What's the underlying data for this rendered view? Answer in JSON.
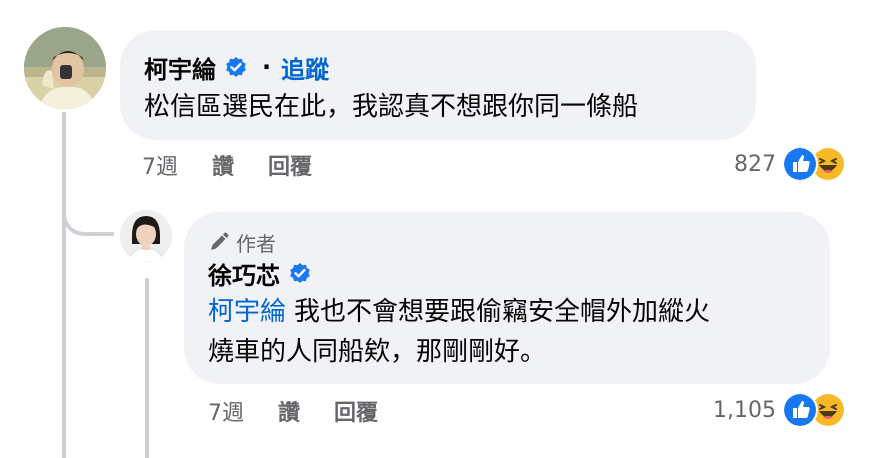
{
  "comment": {
    "author": "柯宇綸",
    "separator": "·",
    "follow_label": "追蹤",
    "text": "松信區選民在此，我認真不想跟你同一條船",
    "time": "7週",
    "like_label": "讚",
    "reply_label": "回覆",
    "reaction_count": "827"
  },
  "reply": {
    "badge_label": "作者",
    "author": "徐巧芯",
    "mention": "柯宇綸",
    "text_line1": "我也不會想要跟偷竊安全帽外加縱火",
    "text_line2": "燒車的人同船欸，那剛剛好。",
    "time": "7週",
    "like_label": "讚",
    "reply_label": "回覆",
    "reaction_count": "1,105"
  },
  "colors": {
    "link": "#0064d1",
    "bubble": "#f0f2f5",
    "meta": "#65676b",
    "verified": "#1877f2"
  },
  "icons": {
    "verified": "verified-badge-icon",
    "like": "like-reaction-icon",
    "haha": "haha-reaction-icon",
    "pen": "pen-icon"
  }
}
